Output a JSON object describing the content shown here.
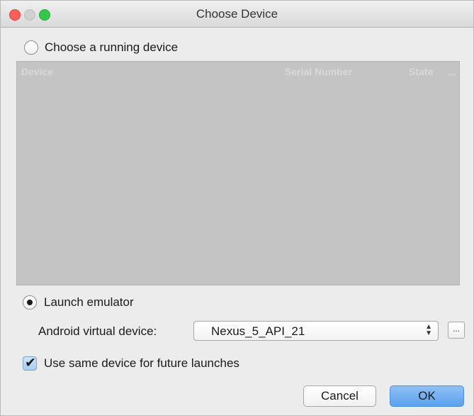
{
  "window": {
    "title": "Choose Device"
  },
  "running_device": {
    "radio_label": "Choose a running device",
    "selected": false,
    "table_columns": [
      "Device",
      "Serial Number",
      "State",
      "..."
    ]
  },
  "emulator": {
    "radio_label": "Launch emulator",
    "selected": true,
    "avd_label": "Android virtual device:",
    "avd_value": "Nexus_5_API_21",
    "browse_label": "..."
  },
  "future_launches": {
    "label": "Use same device for future launches",
    "checked": true
  },
  "buttons": {
    "cancel": "Cancel",
    "ok": "OK"
  },
  "colors": {
    "accent": "#5ba1ee",
    "table_bg": "#c4c4c4"
  }
}
